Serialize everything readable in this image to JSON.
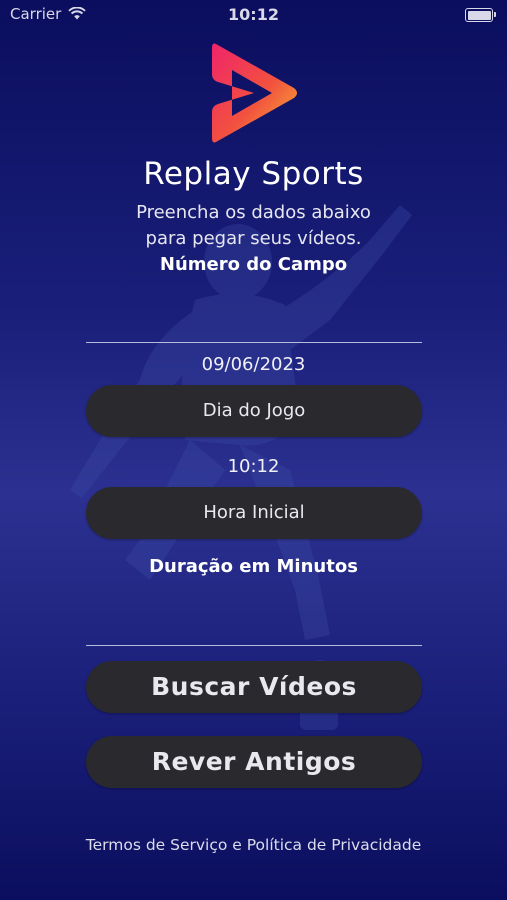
{
  "status_bar": {
    "carrier": "Carrier",
    "time": "10:12",
    "wifi_icon": "wifi-icon",
    "battery_icon": "battery-icon"
  },
  "app": {
    "title": "Replay Sports",
    "subtitle_line1": "Preencha os dados abaixo",
    "subtitle_line2": "para pegar seus vídeos.",
    "logo_icon": "play-logo-icon"
  },
  "form": {
    "field_label": "Número do Campo",
    "field_value": "",
    "date_value": "09/06/2023",
    "date_button": "Dia do Jogo",
    "time_value": "10:12",
    "time_button": "Hora Inicial",
    "duration_label": "Duração em Minutos",
    "duration_value": ""
  },
  "actions": {
    "search_button": "Buscar Vídeos",
    "history_button": "Rever Antigos"
  },
  "footer": {
    "terms_link": "Termos de Serviço e Política de Privacidade"
  },
  "colors": {
    "background_top": "#0b0e5e",
    "background_mid": "#2c3191",
    "button_bg": "#2a2a2e",
    "logo_gradient": [
      "#f0246a",
      "#f7b733"
    ]
  }
}
